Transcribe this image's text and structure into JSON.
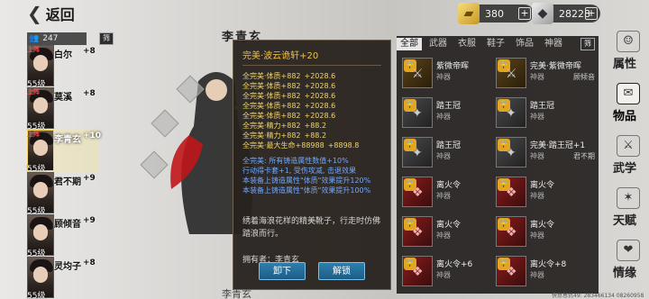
{
  "topbar": {
    "back_label": "返回",
    "gold_value": "380",
    "silver_value": "28228",
    "plus_symbol": "+"
  },
  "hero_list": {
    "count": "247",
    "sort_label": "筛",
    "heroes": [
      {
        "name": "白尔",
        "plus": "+8",
        "level": "55级",
        "tag": "上阵"
      },
      {
        "name": "莫溪",
        "plus": "+8",
        "level": "55级",
        "tag": "上阵"
      },
      {
        "name": "李青玄",
        "plus": "+10",
        "level": "55级",
        "tag": "上阵",
        "selected": true
      },
      {
        "name": "君不期",
        "plus": "+9",
        "level": "55级",
        "tag": ""
      },
      {
        "name": "顾倾音",
        "plus": "+9",
        "level": "55级",
        "tag": ""
      },
      {
        "name": "灵均子",
        "plus": "+8",
        "level": "55级",
        "tag": ""
      }
    ]
  },
  "character": {
    "name": "李青玄",
    "bottom_name": "李青玄"
  },
  "tooltip": {
    "item_name": "完美·波云诡轩+20",
    "attributes": [
      {
        "label": "全完美·体质+882",
        "v1": "+2028.6"
      },
      {
        "label": "全完美·体质+882",
        "v1": "+2028.6"
      },
      {
        "label": "全完美·体质+882",
        "v1": "+2028.6"
      },
      {
        "label": "全完美·体质+882",
        "v1": "+2028.6"
      },
      {
        "label": "全完美·体质+882",
        "v1": "+2028.6"
      },
      {
        "label": "全完美·精力+882",
        "v1": "+88.2"
      },
      {
        "label": "全完美·精力+882",
        "v1": "+88.2"
      },
      {
        "label": "全完美·最大生命+88988",
        "v1": "+8898.8"
      }
    ],
    "blue_lines": [
      "全完美: 所有铸造属性数值+10%",
      "行动得卡套+1, 受伤攻减, 击退效果",
      "本装备上铸造属性\"体质\"效果提升120%",
      "本装备上铸造属性\"体质\"效果提升100%"
    ],
    "description": "绣着海浪花样的精美靴子，行走时仿佛踏浪而行。",
    "owner": "拥有者：李青玄",
    "unequip_label": "卸下",
    "unlock_label": "解锁"
  },
  "inventory": {
    "tabs": [
      "全部",
      "武器",
      "衣服",
      "鞋子",
      "饰品",
      "神器"
    ],
    "active_tab": 0,
    "sort_label": "筛",
    "items": [
      {
        "name": "紫微帝晖",
        "cat": "神器",
        "equipped": "",
        "style": "gold",
        "lock": true
      },
      {
        "name": "完美·紫微帝晖",
        "cat": "神器",
        "equipped": "顾倾音",
        "style": "gold",
        "lock": true
      },
      {
        "name": "踏王冠",
        "cat": "神器",
        "equipped": "",
        "style": "dark",
        "lock": true
      },
      {
        "name": "踏王冠",
        "cat": "神器",
        "equipped": "",
        "style": "dark",
        "lock": true
      },
      {
        "name": "踏王冠",
        "cat": "神器",
        "equipped": "",
        "style": "dark",
        "lock": true
      },
      {
        "name": "完美·踏王冠+1",
        "cat": "神器",
        "equipped": "君不期",
        "style": "dark",
        "lock": true
      },
      {
        "name": "离火令",
        "cat": "神器",
        "equipped": "",
        "style": "red",
        "lock": true
      },
      {
        "name": "离火令",
        "cat": "神器",
        "equipped": "",
        "style": "red",
        "lock": true
      },
      {
        "name": "离火令",
        "cat": "神器",
        "equipped": "",
        "style": "red",
        "lock": true
      },
      {
        "name": "离火令",
        "cat": "神器",
        "equipped": "",
        "style": "red",
        "lock": true
      },
      {
        "name": "离火令+6",
        "cat": "神器",
        "equipped": "",
        "style": "red",
        "lock": true
      },
      {
        "name": "离火令+8",
        "cat": "神器",
        "equipped": "",
        "style": "red",
        "lock": true
      }
    ]
  },
  "side_menu": [
    {
      "label": "属性",
      "icon": "person-icon",
      "active": false
    },
    {
      "label": "物品",
      "icon": "bag-icon",
      "active": true
    },
    {
      "label": "武学",
      "icon": "sword-icon",
      "active": false
    },
    {
      "label": "天赋",
      "icon": "star-icon",
      "active": false
    },
    {
      "label": "情缘",
      "icon": "heart-icon",
      "active": false
    }
  ],
  "footer": "快意恩仇49: 283466134 08260958"
}
